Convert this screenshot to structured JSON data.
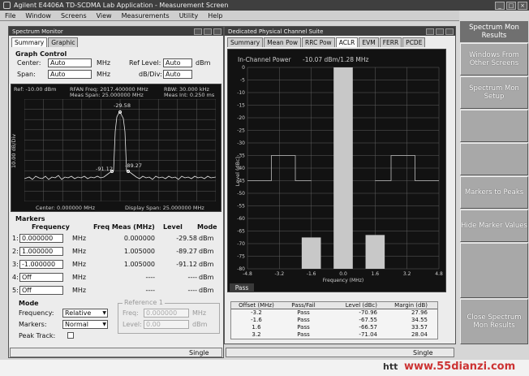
{
  "window": {
    "title": "Agilent E4406A TD-SCDMA Lab Application - Measurement Screen"
  },
  "menu": [
    "File",
    "Window",
    "Screens",
    "View",
    "Measurements",
    "Utility",
    "Help"
  ],
  "left_panel": {
    "title": "Spectrum Monitor",
    "tabs": [
      "Summary",
      "Graphic"
    ],
    "graph_control": {
      "heading": "Graph Control",
      "center_label": "Center:",
      "center_value": "Auto",
      "center_unit": "MHz",
      "span_label": "Span:",
      "span_value": "Auto",
      "span_unit": "MHz",
      "ref_label": "Ref Level:",
      "ref_value": "Auto",
      "ref_unit": "dBm",
      "div_label": "dB/Div:",
      "div_value": "Auto"
    },
    "screen": {
      "ref": "Ref: -10.00 dBm",
      "rfan": "RFAN Freq: 2017.400000 MHz",
      "meas_span": "Meas Span: 25.000000 MHz",
      "rbw": "RBW: 30.000 kHz",
      "meas_int": "Meas Int: 0.250 ms",
      "ylabel": "10.00 dB/Div",
      "center": "Center: 0.000000 MHz",
      "display_span": "Display Span: 25.000000 MHz",
      "mk_top": "-29.58",
      "mk_left": "-91.12",
      "mk_right": "-89.27"
    },
    "markers": {
      "heading": "Markers",
      "col_frequency": "Frequency",
      "col_freq_meas": "Freq Meas (MHz)",
      "col_level": "Level",
      "col_mode": "Mode",
      "rows": [
        {
          "num": "1:",
          "freq": "0.000000",
          "unit": "MHz",
          "meas": "0.000000",
          "level": "-29.58",
          "dunit": "dBm"
        },
        {
          "num": "2:",
          "freq": "1.000000",
          "unit": "MHz",
          "meas": "1.005000",
          "level": "-89.27",
          "dunit": "dBm"
        },
        {
          "num": "3:",
          "freq": "-1.000000",
          "unit": "MHz",
          "meas": "1.005000",
          "level": "-91.12",
          "dunit": "dBm"
        },
        {
          "num": "4:",
          "freq": "Off",
          "unit": "MHz",
          "meas": "----",
          "level": "----",
          "dunit": "dBm"
        },
        {
          "num": "5:",
          "freq": "Off",
          "unit": "MHz",
          "meas": "----",
          "level": "----",
          "dunit": "dBm"
        }
      ]
    },
    "mode": {
      "heading": "Mode",
      "frequency_label": "Frequency:",
      "frequency_value": "Relative",
      "markers_label": "Markers:",
      "markers_value": "Normal",
      "peak_track_label": "Peak Track:"
    },
    "reference": {
      "heading": "Reference 1",
      "freq_label": "Freq:",
      "freq_value": "0.000000",
      "freq_unit": "MHz",
      "level_label": "Level:",
      "level_value": "0.00",
      "level_unit": "dBm"
    },
    "status": "Single"
  },
  "right_panel": {
    "title": "Dedicated Physical Channel Suite",
    "tabs": [
      "Summary",
      "Mean Pow",
      "RRC Pow",
      "ACLR",
      "EVM",
      "FERR",
      "PCDE"
    ],
    "active_tab": "ACLR",
    "screen": {
      "in_channel_label": "In-Channel Power",
      "in_channel_value": "-10.07 dBm/1.28 MHz",
      "ylabel": "Level (dBc)",
      "xlabel": "Frequency (MHz)"
    },
    "pass_badge": "Pass",
    "table": {
      "headers": [
        "Offset (MHz)",
        "Pass/Fail",
        "Level (dBc)",
        "Margin (dB)"
      ],
      "rows": [
        [
          "-3.2",
          "Pass",
          "-70.96",
          "27.96"
        ],
        [
          "-1.6",
          "Pass",
          "-67.55",
          "34.55"
        ],
        [
          "1.6",
          "Pass",
          "-66.57",
          "33.57"
        ],
        [
          "3.2",
          "Pass",
          "-71.04",
          "28.04"
        ]
      ]
    },
    "status": "Single"
  },
  "chart_data": {
    "type": "bar",
    "x_ticks": [
      "-4.8",
      "-3.2",
      "-1.6",
      "0.0",
      "1.6",
      "3.2",
      "4.8"
    ],
    "y_ticks": [
      "0",
      "-5",
      "-10",
      "-15",
      "-20",
      "-25",
      "-30",
      "-35",
      "-40",
      "-45",
      "-50",
      "-55",
      "-60",
      "-65",
      "-70",
      "-75",
      "-80"
    ],
    "ylim": [
      -80,
      0
    ],
    "xlim": [
      -4.8,
      4.8
    ],
    "bars": [
      {
        "x": -1.6,
        "value": -67.55
      },
      {
        "x": 0.0,
        "value": 0
      },
      {
        "x": 1.6,
        "value": -66.57
      }
    ],
    "limit_line": [
      {
        "x": -4.8,
        "y": -45
      },
      {
        "x": -3.6,
        "y": -45
      },
      {
        "x": -3.6,
        "y": -35
      },
      {
        "x": -2.4,
        "y": -35
      },
      {
        "x": -2.4,
        "y": -45
      },
      {
        "x": -1.6,
        "y": -45
      }
    ],
    "limit_line_right": [
      {
        "x": 1.6,
        "y": -45
      },
      {
        "x": 2.4,
        "y": -45
      },
      {
        "x": 2.4,
        "y": -35
      },
      {
        "x": 3.6,
        "y": -35
      },
      {
        "x": 3.6,
        "y": -45
      },
      {
        "x": 4.8,
        "y": -45
      }
    ],
    "xlabel": "Frequency (MHz)",
    "ylabel": "Level (dBc)"
  },
  "side_buttons": {
    "header": "Spectrum Mon Results",
    "items": [
      "Windows From Other Screens",
      "Spectrum Mon Setup",
      "",
      "",
      "Markers to Peaks",
      "Hide Marker Values",
      "",
      "Close Spectrum Mon Results"
    ]
  },
  "bottom": {
    "url_fragment": "htt",
    "watermark": "www.55dianzi.com"
  },
  "colors": {
    "screen_bg": "#121212",
    "trace": "#e8e8e8",
    "grid": "#6a6a6a",
    "bar": "#c8c8c8",
    "softkey": "#a8a8a8"
  }
}
